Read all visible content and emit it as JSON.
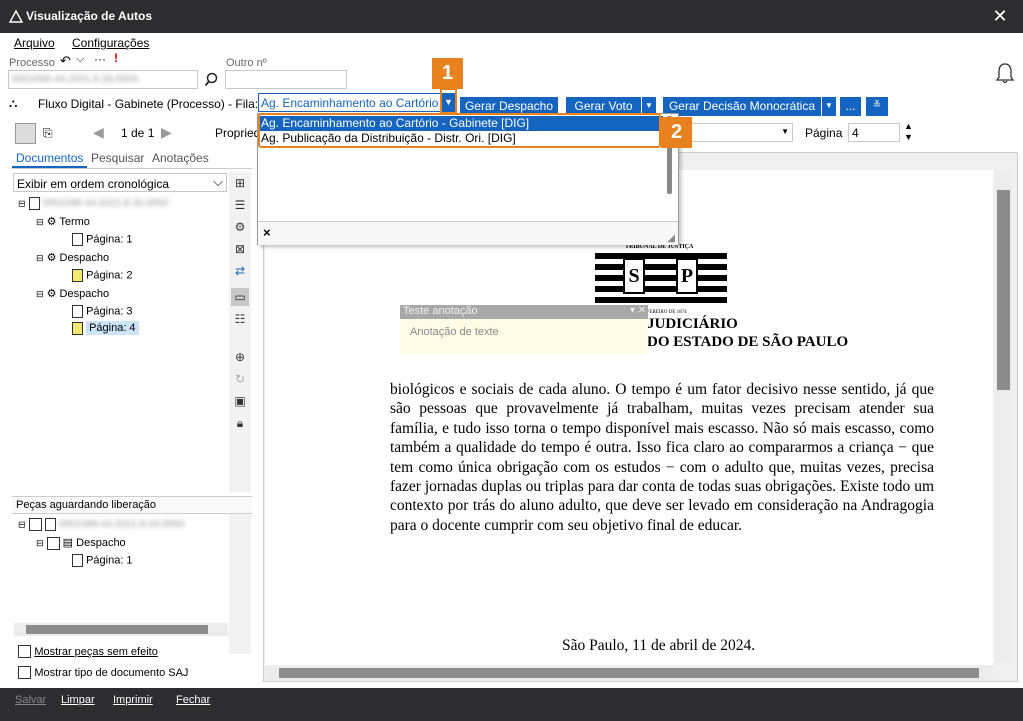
{
  "window": {
    "title": "Visualização de Autos",
    "close": "✕"
  },
  "menu": {
    "file": "Arquivo",
    "settings": "Configurações"
  },
  "process": {
    "label": "Processo",
    "other_label": "Outro nº",
    "number": "0001086-44.2021.8.26.0000",
    "other_value": "",
    "alert": "!"
  },
  "flow": {
    "label": "Fluxo Digital - Gabinete (Processo) - Fila:",
    "selected": "Ag. Encaminhamento ao Cartório",
    "options": [
      "Ag. Encaminhamento ao Cartório - Gabinete [DIG]",
      "Ag. Publicação da Distribuição - Distr. Ori. [DIG]"
    ],
    "close_x": "×"
  },
  "actions": {
    "despacho": "Gerar Despacho",
    "voto": "Gerar Voto",
    "decisao": "Gerar Decisão Monocrática",
    "more": "..."
  },
  "pager": {
    "text": "1 de 1",
    "props": "Propriedades",
    "page_label": "Página",
    "page_value": "4"
  },
  "tabs": {
    "documents": "Documentos",
    "search": "Pesquisar",
    "annotations": "Anotações"
  },
  "order": {
    "value": "Exibir em ordem cronológica"
  },
  "tree": {
    "root": "0001086-44.2021.8.26.0000",
    "items": [
      {
        "doc": "Termo",
        "page": "Página: 1"
      },
      {
        "doc": "Despacho",
        "page": "Página: 2"
      },
      {
        "doc": "Despacho",
        "page": "Página: 3"
      },
      {
        "doc": "",
        "page": "Página: 4"
      }
    ]
  },
  "pending": {
    "title": "Peças aguardando liberação",
    "root": "0001086-44.2021.8.26.0000",
    "doc": "Despacho",
    "page": "Página: 1"
  },
  "options": {
    "no_effect": "Mostrar peças sem efeito",
    "saj_type": "Mostrar tipo de documento SAJ"
  },
  "annotation": {
    "title": "Teste anotação",
    "text": "Anotação de texte"
  },
  "letterhead": {
    "tribunal": "TRIBUNAL DE JUSTIÇA",
    "year": "FEVEREIRO DE 1874",
    "line1": "JUDICIÁRIO",
    "line2": "DO ESTADO DE SÃO PAULO",
    "s": "S",
    "p": "P"
  },
  "doc": {
    "body": "biológicos e sociais de cada aluno. O tempo é um fator decisivo nesse sentido, já que são pessoas que provavelmente já trabalham, muitas vezes precisam atender sua família, e tudo isso torna o tempo disponível mais escasso. Não só mais escasso, como também a qualidade do tempo é outra. Isso fica claro ao compararmos a criança − que tem como única obrigação com os estudos − com o adulto que, muitas vezes, precisa fazer jornadas duplas ou triplas para dar conta de todas suas obrigações. Existe todo um contexto por trás do aluno adulto, que deve ser levado em consideração na Andragogia para o docente cumprir com seu objetivo final de educar.",
    "date": "São Paulo, 11 de abril de 2024."
  },
  "badges": {
    "one": "1",
    "two": "2"
  },
  "footer": {
    "save": "Salvar",
    "clear": "Limpar",
    "print": "Imprimir",
    "close": "Fechar"
  },
  "colors": {
    "titlebar": "#2d2d30",
    "accent": "#1565c0",
    "badge": "#e8821e",
    "yellow": "#f3e96e"
  }
}
